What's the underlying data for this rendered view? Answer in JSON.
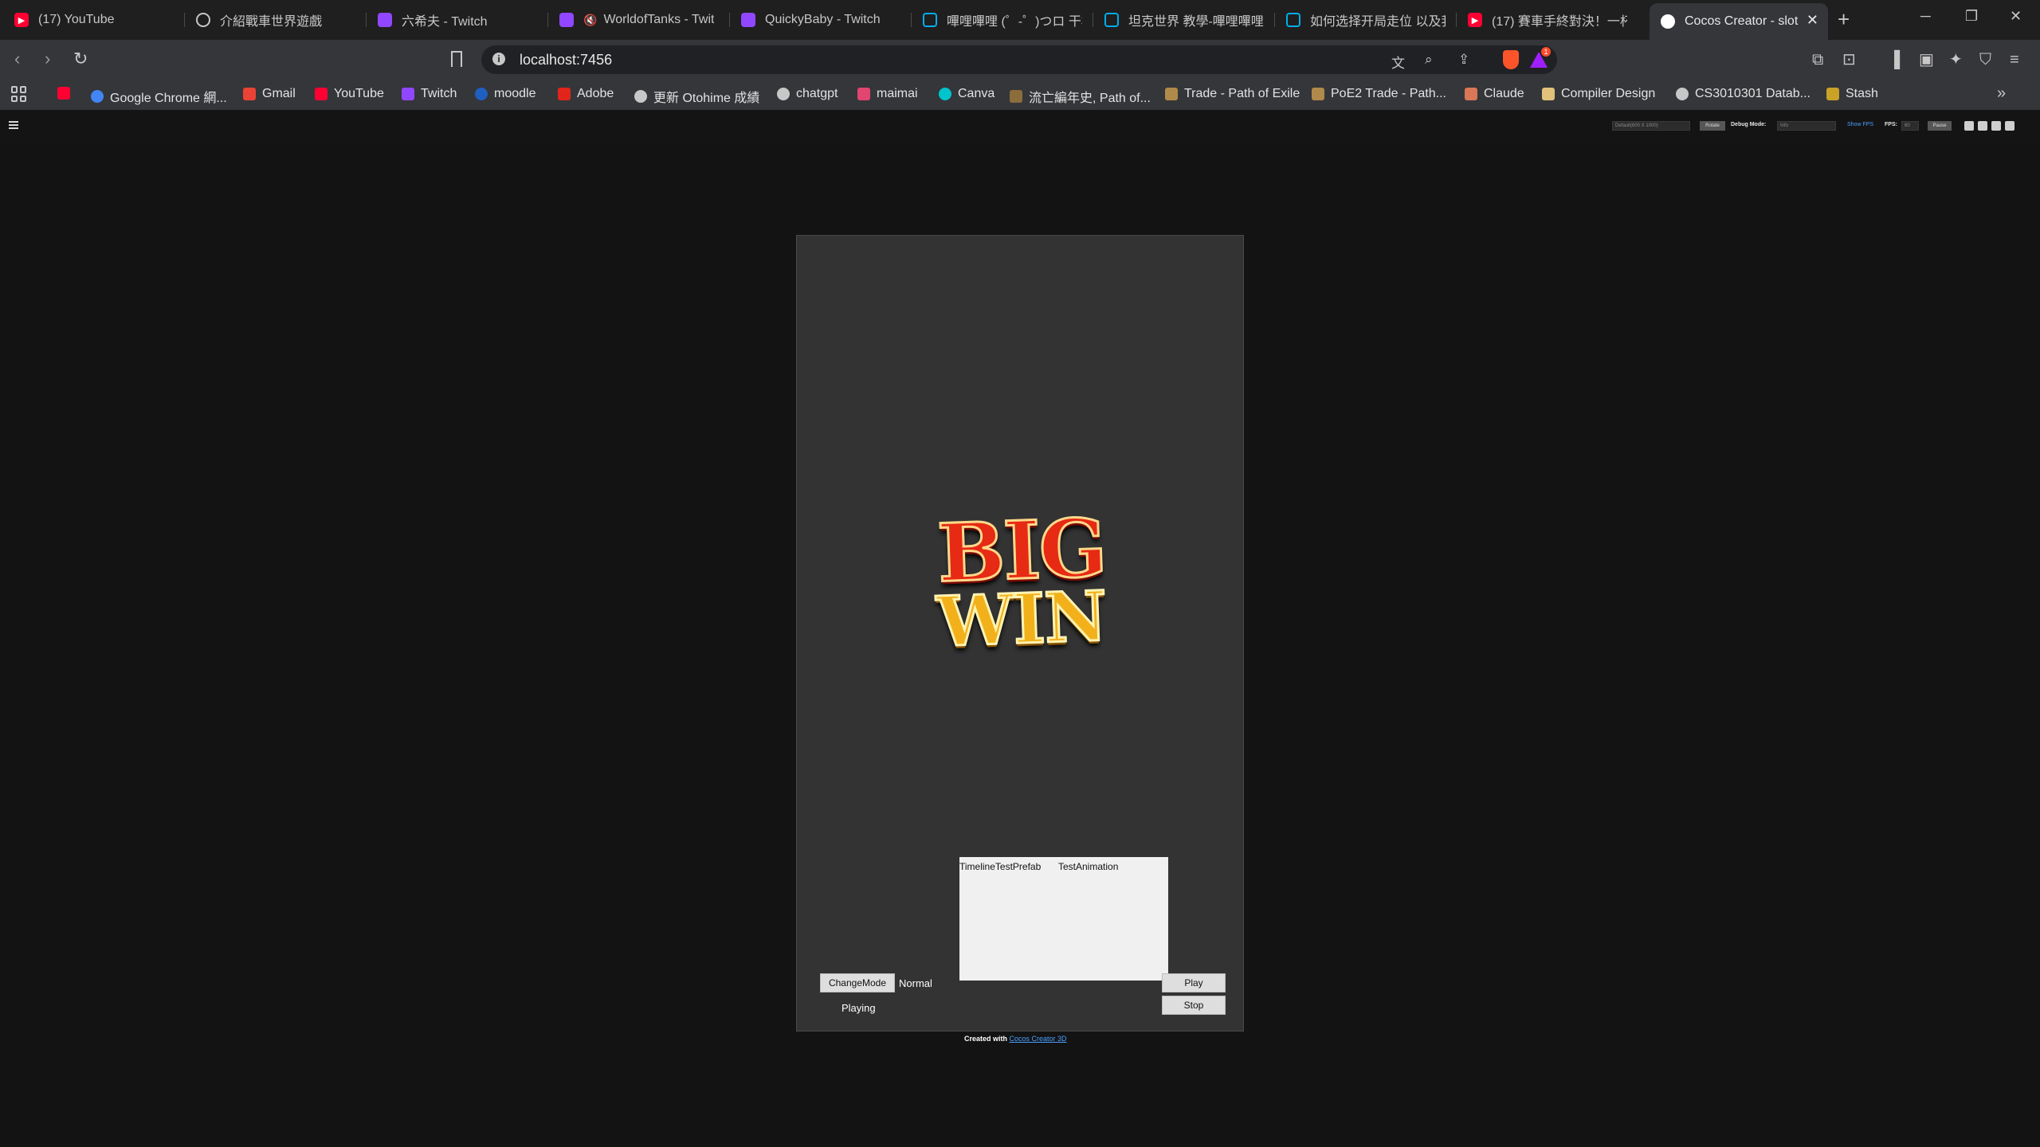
{
  "browser": {
    "tabs": [
      {
        "title": "(17) YouTube",
        "icon": "youtube-icon"
      },
      {
        "title": "介紹戰車世界遊戲",
        "icon": "gear-icon"
      },
      {
        "title": "六希夫 - Twitch",
        "icon": "twitch-icon"
      },
      {
        "title": "WorldofTanks - Twit",
        "icon": "twitch-icon"
      },
      {
        "title": "QuickyBaby - Twitch",
        "icon": "twitch-icon"
      },
      {
        "title": "嗶哩嗶哩 (゜-゜)つロ 干杯",
        "icon": "bilibili-icon"
      },
      {
        "title": "坦克世界 教學-嗶哩嗶哩",
        "icon": "bilibili-icon"
      },
      {
        "title": "如何选择开局走位 以及我",
        "icon": "bilibili-icon"
      },
      {
        "title": "(17) 賽車手終對決！一杯",
        "icon": "youtube-icon"
      },
      {
        "title": "Cocos Creator - slot",
        "icon": "globe-icon"
      }
    ],
    "url": "localhost:7456",
    "extension_badge": "1",
    "bookmarks": [
      {
        "label": "",
        "icon": "youtube-icon",
        "color": "#ff0033"
      },
      {
        "label": "Google Chrome 網...",
        "icon": "chrome-icon",
        "color": "#4285f4"
      },
      {
        "label": "Gmail",
        "icon": "gmail-icon",
        "color": "#ea4335"
      },
      {
        "label": "YouTube",
        "icon": "youtube-icon",
        "color": "#ff0033"
      },
      {
        "label": "Twitch",
        "icon": "twitch-icon",
        "color": "#9146ff"
      },
      {
        "label": "moodle",
        "icon": "moodle-icon",
        "color": "#1f5fbf"
      },
      {
        "label": "Adobe",
        "icon": "adobe-icon",
        "color": "#e1251b"
      },
      {
        "label": "更新 Otohime 成績",
        "icon": "globe-icon",
        "color": "#c7c7c7"
      },
      {
        "label": "chatgpt",
        "icon": "chatgpt-icon",
        "color": "#c7c7c7"
      },
      {
        "label": "maimai",
        "icon": "maimai-icon",
        "color": "#e2456f"
      },
      {
        "label": "Canva",
        "icon": "canva-icon",
        "color": "#00c4cc"
      },
      {
        "label": "流亡編年史, Path of...",
        "icon": "poe-icon",
        "color": "#8a6d3b"
      },
      {
        "label": "Trade - Path of Exile",
        "icon": "poe-icon",
        "color": "#b08a4a"
      },
      {
        "label": "PoE2 Trade - Path...",
        "icon": "poe-icon",
        "color": "#b08a4a"
      },
      {
        "label": "Claude",
        "icon": "claude-icon",
        "color": "#d97757"
      },
      {
        "label": "Compiler Design",
        "icon": "image-icon",
        "color": "#e0c27a"
      },
      {
        "label": "CS3010301 Datab...",
        "icon": "globe-icon",
        "color": "#c7c7c7"
      },
      {
        "label": "Stash",
        "icon": "stash-icon",
        "color": "#c9a227"
      }
    ]
  },
  "cocos": {
    "resolution": "Default(600 X 1000)",
    "rotate": "Rotate",
    "debug_mode_label": "Debug Mode:",
    "debug_mode_value": "Info",
    "show_fps": "Show FPS",
    "fps_label": "FPS:",
    "fps_value": "60",
    "pause": "Pause"
  },
  "game": {
    "logo_line1": "BIG",
    "logo_line2": "WIN",
    "panel_tabs": [
      "TimelineTestPrefab",
      "TestAnimation"
    ],
    "change_mode_label": "ChangeMode",
    "mode_value": "Normal",
    "status": "Playing",
    "play_label": "Play",
    "stop_label": "Stop"
  },
  "footer": {
    "created_with": "Created with",
    "link_text": "Cocos Creator 3D"
  }
}
